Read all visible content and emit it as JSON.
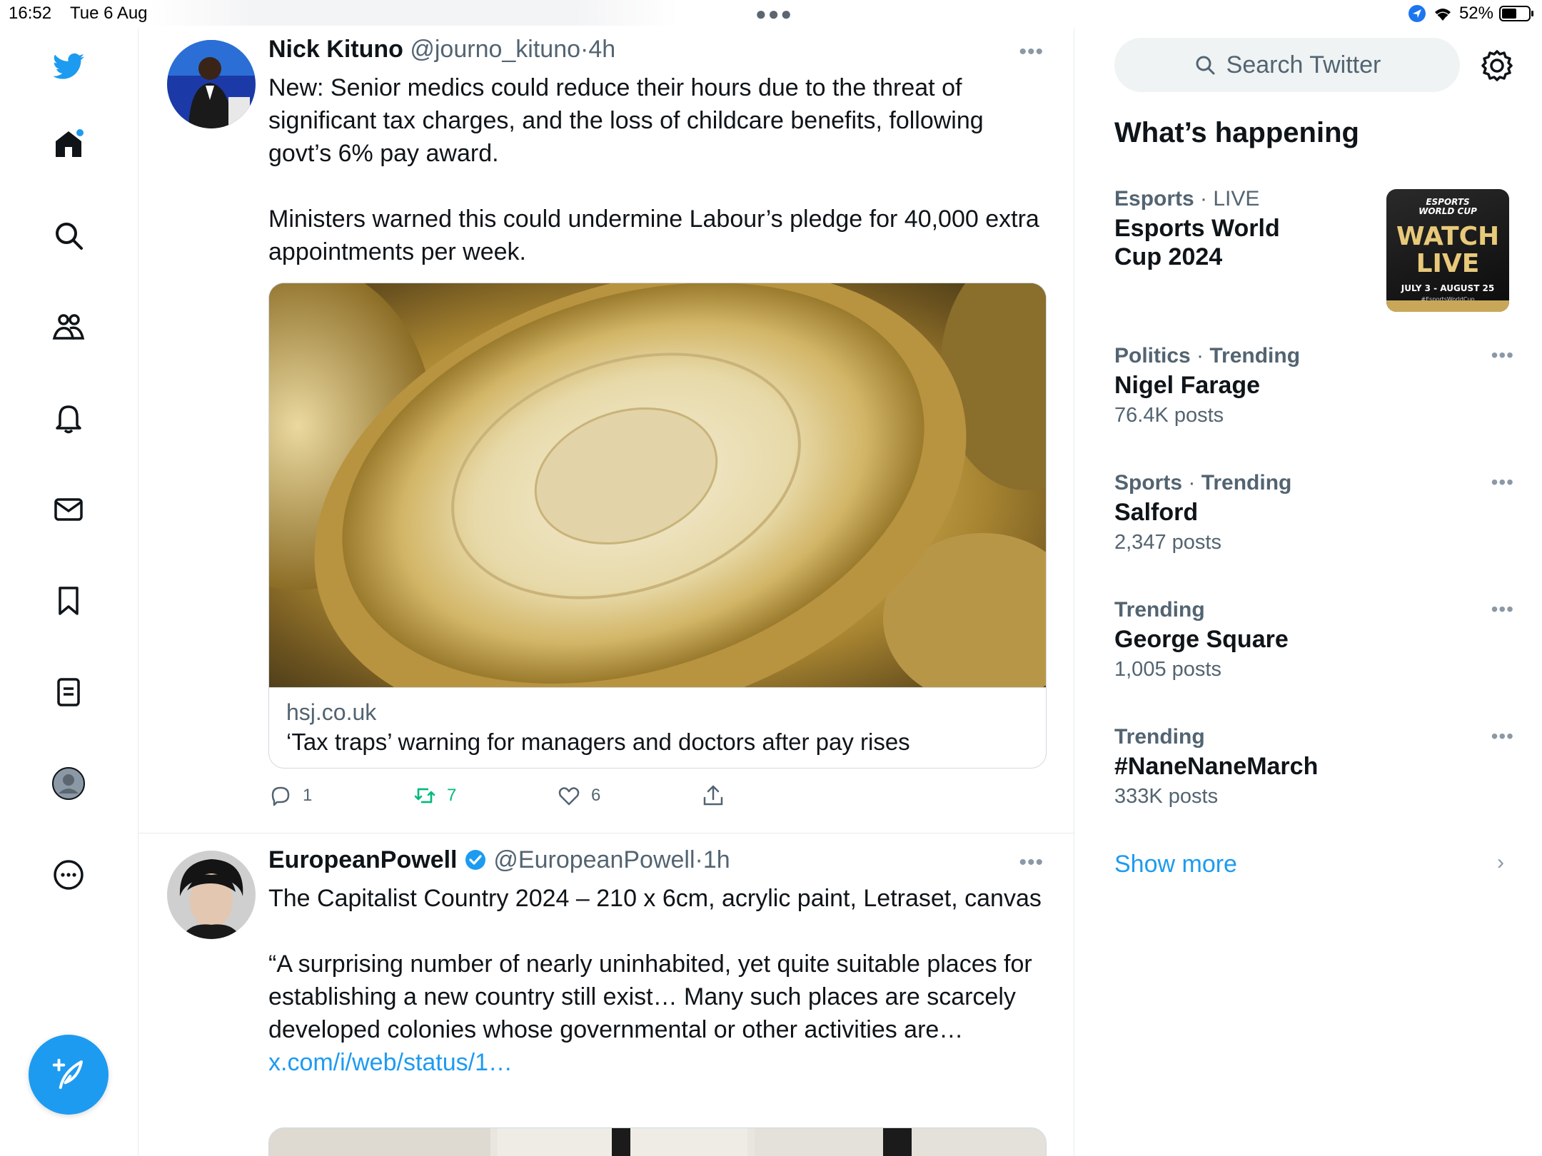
{
  "status_bar": {
    "time": "16:52",
    "date": "Tue 6 Aug",
    "battery": "52%"
  },
  "nav": {
    "items": [
      {
        "name": "home-icon"
      },
      {
        "name": "explore-icon"
      },
      {
        "name": "communities-icon"
      },
      {
        "name": "notifications-icon"
      },
      {
        "name": "messages-icon"
      },
      {
        "name": "bookmarks-icon"
      },
      {
        "name": "lists-icon"
      },
      {
        "name": "profile-icon"
      },
      {
        "name": "more-icon"
      }
    ],
    "compose_icon": "feather-plus-icon"
  },
  "timeline": {
    "tweets": [
      {
        "display_name": "Nick Kituno",
        "handle": "@journo_kituno",
        "sep": "·",
        "time": "4h",
        "verified": false,
        "text_paragraphs": [
          "New: Senior medics could reduce their hours due to the threat of significant tax charges, and the loss of childcare benefits, following govt’s 6% pay award.",
          "Ministers warned this could undermine Labour’s pledge for 40,000 extra appointments per week."
        ],
        "card": {
          "domain": "hsj.co.uk",
          "title": "‘Tax traps’ warning for managers and doctors after pay rises"
        },
        "replies": "1",
        "retweets": "7",
        "likes": "6"
      },
      {
        "display_name": "EuropeanPowell",
        "handle": "@EuropeanPowell",
        "sep": "·",
        "time": "1h",
        "verified": true,
        "text_paragraphs": [
          "The Capitalist Country 2024 – 210 x 6cm, acrylic paint, Letraset, canvas",
          "“A surprising number of nearly uninhabited, yet quite suitable places for establishing a new country still exist… Many such places are scarcely developed colonies whose governmental or other activities are…"
        ],
        "link_text": "x.com/i/web/status/1…"
      }
    ]
  },
  "sidebar": {
    "search_placeholder": "Search Twitter",
    "section_title": "What’s happening",
    "trends": [
      {
        "category": "Esports",
        "qualifier": "LIVE",
        "name": "Esports World Cup 2024",
        "count": ""
      },
      {
        "category": "Politics",
        "qualifier": "Trending",
        "name": "Nigel Farage",
        "count": "76.4K posts"
      },
      {
        "category": "Sports",
        "qualifier": "Trending",
        "name": "Salford",
        "count": "2,347 posts"
      },
      {
        "category": "",
        "qualifier": "Trending",
        "name": "George Square",
        "count": "1,005 posts"
      },
      {
        "category": "",
        "qualifier": "Trending",
        "name": "#NaneNaneMarch",
        "count": "333K posts"
      }
    ],
    "esports_thumb": {
      "logo": "ESPORTS WORLD CUP",
      "cta": "WATCH LIVE",
      "dates": "JULY 3 - AUGUST 25",
      "hashtag": "#EsportsWorldCup"
    },
    "show_more": "Show more"
  },
  "colors": {
    "accent": "#1d9bf0",
    "retweet_green": "#00ba7c",
    "text_primary": "#0f1419",
    "text_secondary": "#536471"
  }
}
